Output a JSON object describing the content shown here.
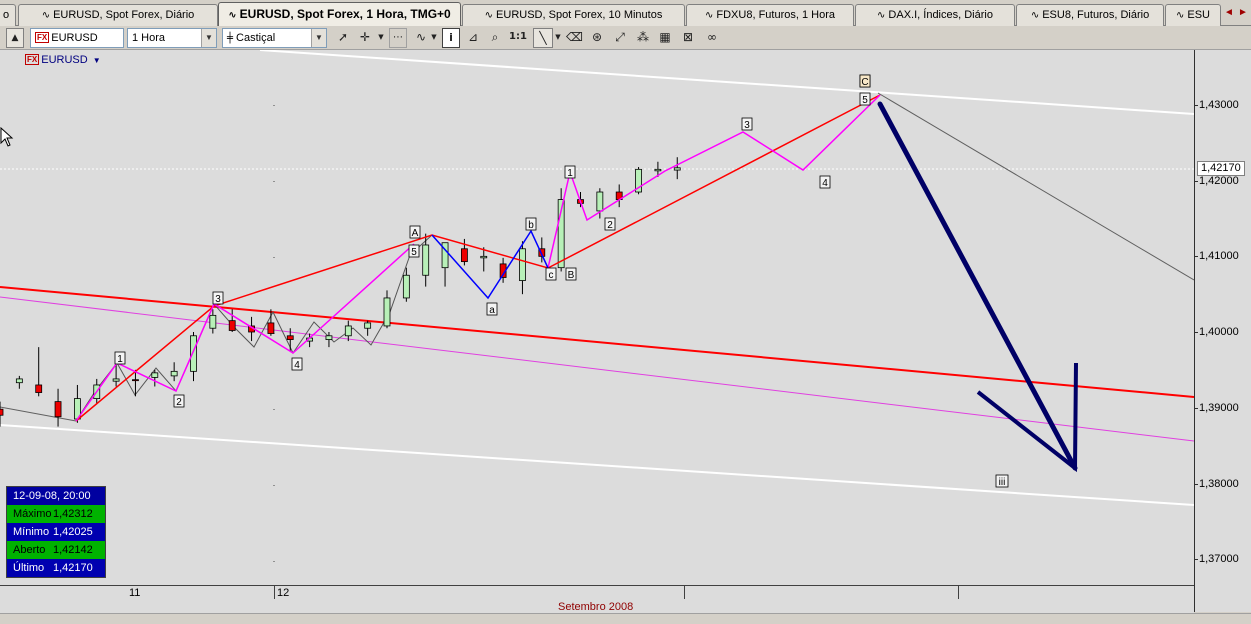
{
  "tabs": [
    {
      "label": "o",
      "icon": "",
      "active": false
    },
    {
      "label": "EURUSD, Spot Forex, Diário",
      "icon": "∿",
      "active": false
    },
    {
      "label": "EURUSD, Spot Forex, 1 Hora, TMG+0",
      "icon": "∿",
      "active": true
    },
    {
      "label": "EURUSD, Spot Forex, 10 Minutos",
      "icon": "∿",
      "active": false
    },
    {
      "label": "FDXU8, Futuros, 1 Hora",
      "icon": "∿",
      "active": false
    },
    {
      "label": "DAX.I, Índices, Diário",
      "icon": "∿",
      "active": false
    },
    {
      "label": "ESU8, Futuros, Diário",
      "icon": "∿",
      "active": false
    },
    {
      "label": "ESU",
      "icon": "∿",
      "active": false
    }
  ],
  "tab_nav": {
    "left": "◄",
    "right": "►"
  },
  "toolbar": {
    "symbol_badge": "FX",
    "symbol_value": "EURUSD",
    "period_value": "1 Hora",
    "style_value": "Castiçal",
    "icons": [
      "up-arrow-icon",
      "pointer-icon",
      "crosshair-icon",
      "grid-icon",
      "wave-icon",
      "info-icon",
      "line-tool-icon",
      "zoom-icon",
      "one-to-one-icon",
      "trendline-icon",
      "eraser-icon",
      "template-icon",
      "arrows-icon",
      "pattern-icon",
      "calculator-icon",
      "pattern2-icon",
      "glasses-icon"
    ],
    "one_to_one": "1:1"
  },
  "chart_header": {
    "badge": "FX",
    "symbol": "EURUSD"
  },
  "price_axis": {
    "ticks": [
      "1,43000",
      "1,42000",
      "1,41000",
      "1,40000",
      "1,39000",
      "1,38000",
      "1,37000"
    ],
    "last_price": "1,42170"
  },
  "time_axis": {
    "days": [
      "11",
      "12"
    ],
    "month": "Setembro 2008"
  },
  "data_window": {
    "header": "12-09-08, 20:00",
    "rows": [
      {
        "label": "Máximo",
        "value": "1,42312",
        "style": "green"
      },
      {
        "label": "Mínimo",
        "value": "1,42025",
        "style": "blue"
      },
      {
        "label": "Aberto",
        "value": "1,42142",
        "style": "green"
      },
      {
        "label": "Último",
        "value": "1,42170",
        "style": "blue"
      }
    ]
  },
  "wave_labels": [
    "1",
    "2",
    "3",
    "4",
    "5",
    "A",
    "B",
    "C",
    "a",
    "b",
    "c",
    "1",
    "2",
    "3",
    "4",
    "5",
    "C",
    "iii"
  ],
  "chart_data": {
    "type": "candlestick",
    "symbol": "EURUSD",
    "timeframe": "1 Hora",
    "y_range": [
      1.367,
      1.437
    ],
    "candles": [
      {
        "o": 1.3898,
        "h": 1.3908,
        "l": 1.3875,
        "c": 1.389
      },
      {
        "o": 1.3933,
        "h": 1.3942,
        "l": 1.3925,
        "c": 1.3938
      },
      {
        "o": 1.393,
        "h": 1.398,
        "l": 1.3915,
        "c": 1.392
      },
      {
        "o": 1.3908,
        "h": 1.3925,
        "l": 1.3875,
        "c": 1.3888
      },
      {
        "o": 1.3885,
        "h": 1.393,
        "l": 1.388,
        "c": 1.3912
      },
      {
        "o": 1.3912,
        "h": 1.3938,
        "l": 1.3905,
        "c": 1.393
      },
      {
        "o": 1.3935,
        "h": 1.3958,
        "l": 1.3928,
        "c": 1.3938
      },
      {
        "o": 1.3937,
        "h": 1.395,
        "l": 1.3915,
        "c": 1.3936
      },
      {
        "o": 1.394,
        "h": 1.395,
        "l": 1.3928,
        "c": 1.3946
      },
      {
        "o": 1.3942,
        "h": 1.396,
        "l": 1.3935,
        "c": 1.3948
      },
      {
        "o": 1.3948,
        "h": 1.4,
        "l": 1.3935,
        "c": 1.3995
      },
      {
        "o": 1.4005,
        "h": 1.403,
        "l": 1.3998,
        "c": 1.4022
      },
      {
        "o": 1.4015,
        "h": 1.403,
        "l": 1.4,
        "c": 1.4002
      },
      {
        "o": 1.4008,
        "h": 1.402,
        "l": 1.3988,
        "c": 1.4
      },
      {
        "o": 1.4012,
        "h": 1.403,
        "l": 1.3995,
        "c": 1.3998
      },
      {
        "o": 1.3995,
        "h": 1.4005,
        "l": 1.3975,
        "c": 1.399
      },
      {
        "o": 1.3988,
        "h": 1.3998,
        "l": 1.398,
        "c": 1.3992
      },
      {
        "o": 1.399,
        "h": 1.4,
        "l": 1.398,
        "c": 1.3995
      },
      {
        "o": 1.3995,
        "h": 1.4015,
        "l": 1.3988,
        "c": 1.4008
      },
      {
        "o": 1.4005,
        "h": 1.4015,
        "l": 1.3995,
        "c": 1.4012
      },
      {
        "o": 1.4008,
        "h": 1.4055,
        "l": 1.4005,
        "c": 1.4045
      },
      {
        "o": 1.4045,
        "h": 1.4085,
        "l": 1.404,
        "c": 1.4075
      },
      {
        "o": 1.4075,
        "h": 1.413,
        "l": 1.406,
        "c": 1.4115
      },
      {
        "o": 1.4085,
        "h": 1.4115,
        "l": 1.406,
        "c": 1.4118
      },
      {
        "o": 1.411,
        "h": 1.4123,
        "l": 1.4088,
        "c": 1.4093
      },
      {
        "o": 1.4098,
        "h": 1.4112,
        "l": 1.408,
        "c": 1.41
      },
      {
        "o": 1.409,
        "h": 1.4098,
        "l": 1.4065,
        "c": 1.4072
      },
      {
        "o": 1.4068,
        "h": 1.412,
        "l": 1.405,
        "c": 1.411
      },
      {
        "o": 1.411,
        "h": 1.4125,
        "l": 1.4092,
        "c": 1.41
      },
      {
        "o": 1.4085,
        "h": 1.419,
        "l": 1.408,
        "c": 1.4175
      },
      {
        "o": 1.4175,
        "h": 1.4185,
        "l": 1.4165,
        "c": 1.417
      },
      {
        "o": 1.416,
        "h": 1.419,
        "l": 1.415,
        "c": 1.4185
      },
      {
        "o": 1.4185,
        "h": 1.4195,
        "l": 1.4165,
        "c": 1.4175
      },
      {
        "o": 1.4185,
        "h": 1.4218,
        "l": 1.4182,
        "c": 1.4215
      },
      {
        "o": 1.4213,
        "h": 1.4225,
        "l": 1.4205,
        "c": 1.4215
      },
      {
        "o": 1.4214,
        "h": 1.4231,
        "l": 1.4202,
        "c": 1.4217
      }
    ]
  }
}
